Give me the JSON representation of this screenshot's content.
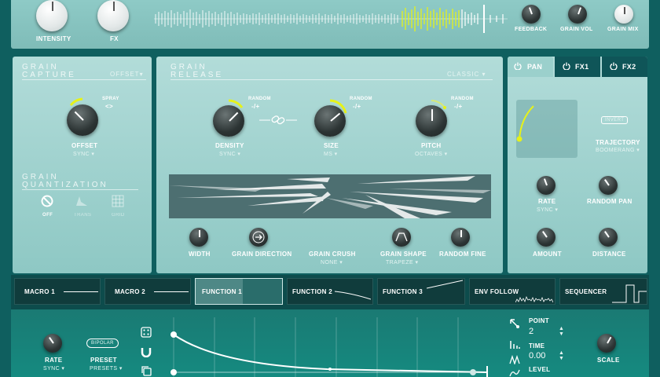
{
  "top": {
    "intensity_label": "INTENSITY",
    "fx_label": "FX",
    "feedback_label": "FEEDBACK",
    "grain_vol_label": "GRAIN VOL",
    "grain_mix_label": "GRAIN MIX"
  },
  "capture": {
    "title_line1": "GRAIN",
    "title_line2": "CAPTURE",
    "mode": "OFFSET",
    "spray_label": "SPRAY",
    "spray_value": "<>",
    "offset_label": "OFFSET",
    "offset_sub": "SYNC"
  },
  "quantization": {
    "title_line1": "GRAIN",
    "title_line2": "QUANTIZATION",
    "options": [
      "OFF",
      "TRANS",
      "GRID"
    ]
  },
  "release": {
    "title_line1": "GRAIN",
    "title_line2": "RELEASE",
    "mode": "CLASSIC",
    "random_label": "RANDOM",
    "random_value": "-/+",
    "density_label": "DENSITY",
    "density_sub": "SYNC",
    "size_label": "SIZE",
    "size_sub": "MS",
    "pitch_label": "PITCH",
    "pitch_sub": "OCTAVES",
    "width_label": "WIDTH",
    "direction_label": "GRAIN DIRECTION",
    "crush_label": "GRAIN CRUSH",
    "crush_sub": "NONE",
    "shape_label": "GRAIN SHAPE",
    "shape_sub": "TRAPEZE",
    "random_fine_label": "RANDOM FINE"
  },
  "pan": {
    "tabs": [
      "PAN",
      "FX1",
      "FX2"
    ],
    "invert_label": "INVERT",
    "trajectory_label": "TRAJECTORY",
    "trajectory_sub": "BOOMERANG",
    "rate_label": "RATE",
    "rate_sub": "SYNC",
    "random_pan_label": "RANDOM PAN",
    "amount_label": "AMOUNT",
    "distance_label": "DISTANCE"
  },
  "mod_tabs": [
    "MACRO 1",
    "MACRO 2",
    "FUNCTION 1",
    "FUNCTION 2",
    "FUNCTION 3",
    "ENV FOLLOW",
    "SEQUENCER"
  ],
  "function": {
    "rate_label": "RATE",
    "rate_sub": "SYNC",
    "bipolar_label": "BIPOLAR",
    "preset_label": "PRESET",
    "preset_sub": "PRESETS",
    "point_label": "POINT",
    "point_value": "2",
    "time_label": "TIME",
    "time_value": "0.00",
    "level_label": "LEVEL",
    "scale_label": "SCALE"
  },
  "colors": {
    "accent_yellow": "#e6f21a",
    "teal_panel": "#9fd0cc",
    "dark_teal": "#0f5f5f"
  }
}
